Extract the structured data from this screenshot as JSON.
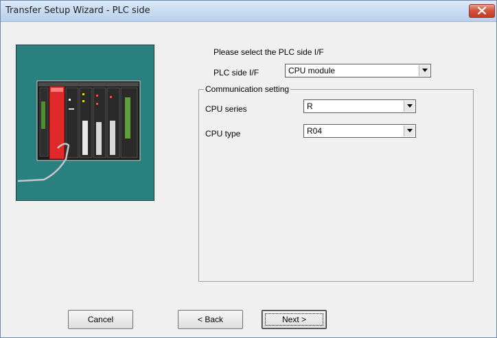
{
  "window": {
    "title": "Transfer Setup Wizard - PLC side",
    "close_icon": "close-icon"
  },
  "prompt": "Please select the PLC side I/F",
  "plc_side_if": {
    "label": "PLC side I/F",
    "value": "CPU module"
  },
  "communication": {
    "group_label": "Communication setting",
    "cpu_series": {
      "label": "CPU series",
      "value": "R"
    },
    "cpu_type": {
      "label": "CPU type",
      "value": "R04"
    }
  },
  "buttons": {
    "cancel": "Cancel",
    "back": "< Back",
    "next": "Next >"
  },
  "colors": {
    "illustration_bg": "#2a7f7f",
    "cpu_module": "#e02a2a",
    "title_bar": "#c9dcf2",
    "close_button": "#c23b24"
  }
}
